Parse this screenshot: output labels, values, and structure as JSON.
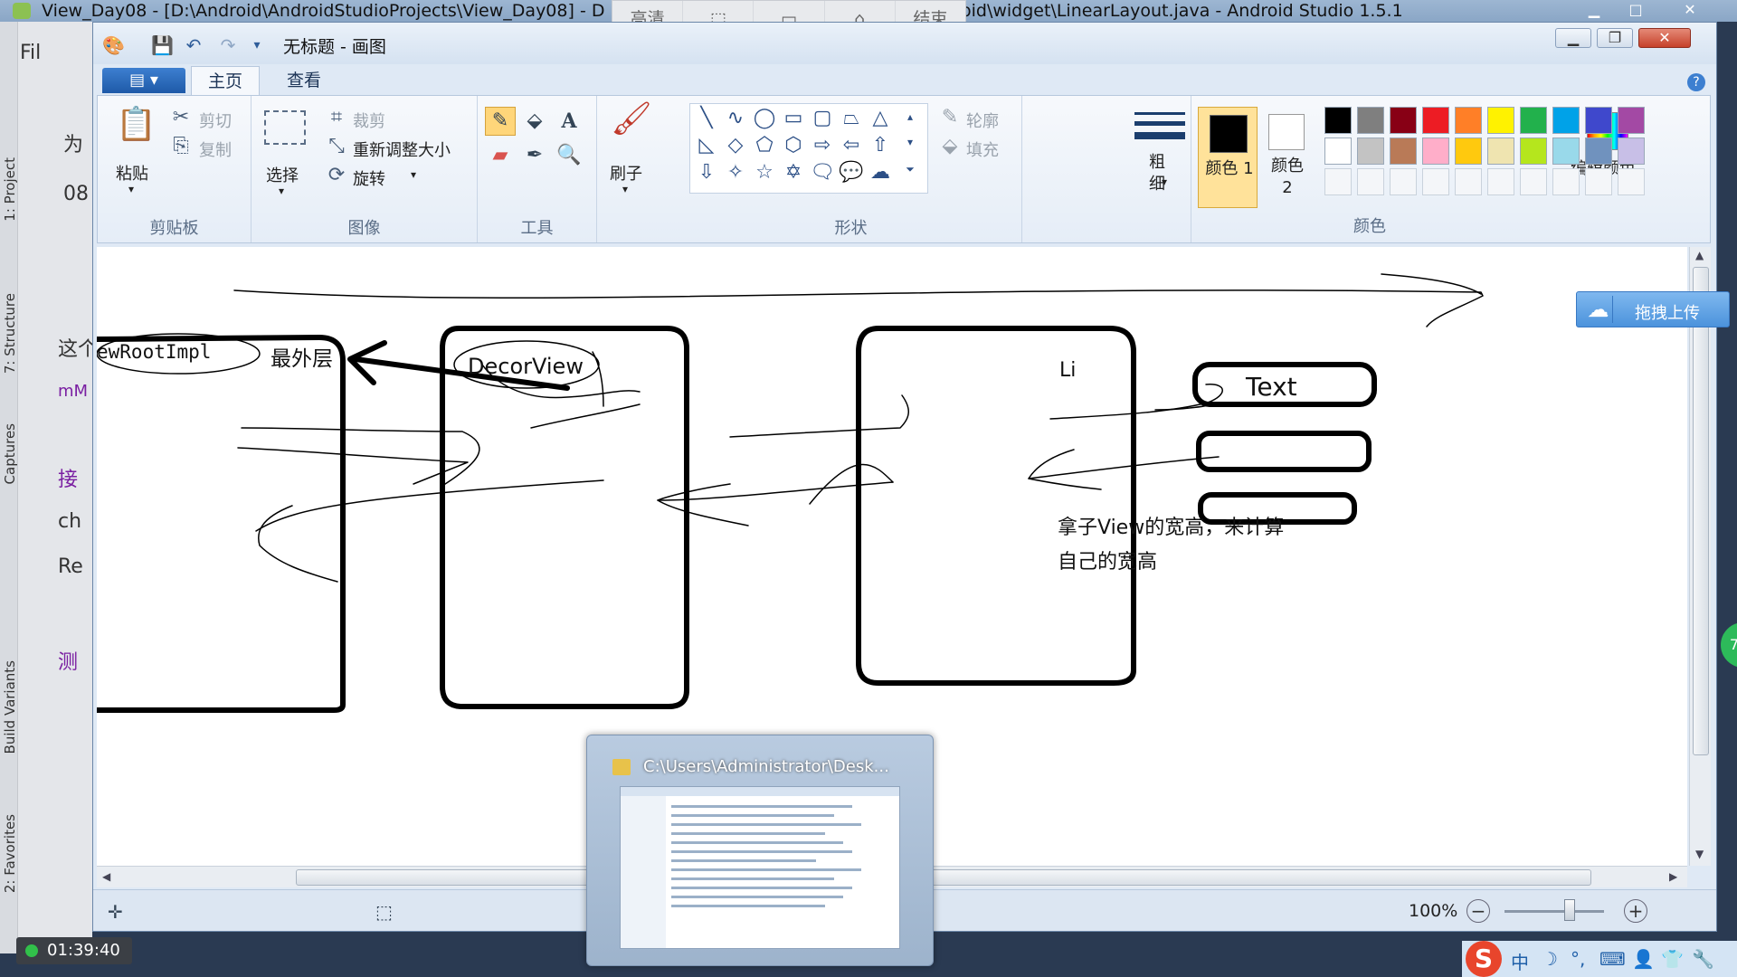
{
  "android_studio": {
    "title": "View_Day08 - [D:\\Android\\AndroidStudioProjects\\View_Day08] - D",
    "title_right": "oid\\widget\\LinearLayout.java - Android Studio 1.5.1",
    "side_tabs": [
      "1: Project",
      "7: Structure",
      "Captures",
      "Build Variants",
      "2: Favorites"
    ],
    "code_fragments": [
      "Fil",
      "为",
      "08",
      "这个",
      "mM",
      "接",
      "ch",
      "Re",
      "测"
    ]
  },
  "recorder": {
    "toolbar": [
      "高清",
      "",
      "",
      "",
      "结束"
    ],
    "timer": "01:39:40",
    "status_color": "#31c04a"
  },
  "paint": {
    "title": "无标题 - 画图",
    "tabs": [
      "主页",
      "查看"
    ],
    "groups": {
      "clipboard": {
        "label": "剪贴板",
        "paste": "粘贴",
        "cut": "剪切",
        "copy": "复制"
      },
      "image": {
        "label": "图像",
        "select": "选择",
        "crop": "裁剪",
        "resize": "重新调整大小",
        "rotate": "旋转"
      },
      "tools": {
        "label": "工具"
      },
      "brushes": {
        "label": "刷子"
      },
      "shapes": {
        "label": "形状",
        "outline": "轮廓",
        "fill": "填充"
      },
      "size": {
        "label": "粗细"
      },
      "colors": {
        "label": "颜色",
        "color1": "颜色 1",
        "color2": "颜色 2",
        "edit": "编辑颜色"
      }
    },
    "palette_row1": [
      "#000000",
      "#7f7f7f",
      "#880015",
      "#ed1c24",
      "#ff7f27",
      "#fff200",
      "#22b14c",
      "#00a2e8",
      "#3f48cc",
      "#a349a4"
    ],
    "palette_row2": [
      "#ffffff",
      "#c3c3c3",
      "#b97a57",
      "#ffaec9",
      "#ffc90e",
      "#efe4b0",
      "#b5e61d",
      "#99d9ea",
      "#7092be",
      "#c8bfe7"
    ],
    "canvas": {
      "view_root_label": "ewRootImpl",
      "outermost_label": "最外层",
      "decor_view_label": "DecorView",
      "li_label": "Li",
      "textview_label": "Text",
      "note_line1": "拿子View的宽高，来计算",
      "note_line2": "自己的宽高"
    },
    "zoom": "100%"
  },
  "upload": {
    "label": "拖拽上传"
  },
  "thumbnail": {
    "title": "C:\\Users\\Administrator\\Desk..."
  },
  "tray": {
    "ime": "S",
    "items": [
      "中",
      "☽",
      "°,",
      "⌨",
      "👤",
      "👕",
      "🔧"
    ]
  }
}
